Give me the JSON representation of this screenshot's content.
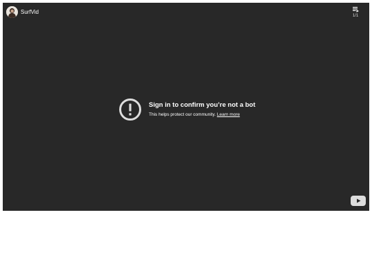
{
  "channel": {
    "name": "SurfVid",
    "avatar_icon": "channel-avatar"
  },
  "playlist": {
    "icon": "playlist-icon",
    "count": "1/1"
  },
  "message": {
    "icon": "alert-circle-icon",
    "title": "Sign in to confirm you’re not a bot",
    "subtitle": "This helps protect our community.",
    "link": "Learn more"
  },
  "logo_button": {
    "icon": "play-logo-icon"
  },
  "colors": {
    "player_background": "#282828",
    "page_background": "#ffffff",
    "text": "#ffffff",
    "logo": "#dddddd"
  }
}
